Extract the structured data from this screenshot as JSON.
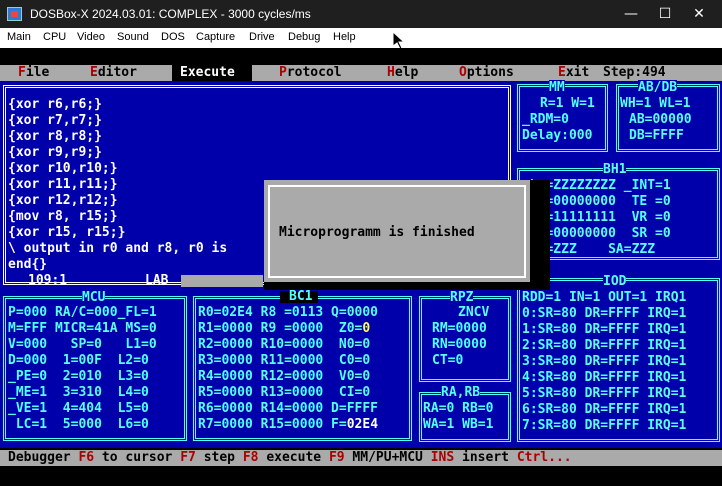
{
  "window": {
    "title": "DOSBox-X 2024.03.01: COMPLEX - 3000 cycles/ms",
    "icon": "dosbox-icon",
    "controls": {
      "minimize": "—",
      "maximize": "☐",
      "close": "✕"
    }
  },
  "menubar": [
    "Main",
    "CPU",
    "Video",
    "Sound",
    "DOS",
    "Capture",
    "Drive",
    "Debug",
    "Help"
  ],
  "topmenu": {
    "file": {
      "hot": "F",
      "rest": "ile"
    },
    "editor": {
      "hot": "E",
      "rest": "ditor"
    },
    "execute": {
      "hot": "E",
      "rest": "xecute"
    },
    "protocol": {
      "hot": "P",
      "rest": "rotocol"
    },
    "help": {
      "hot": "H",
      "rest": "elp"
    },
    "options": {
      "hot": "O",
      "rest": "ptions"
    },
    "exit": {
      "hot": "E",
      "rest": "xit"
    },
    "step": "Step:494"
  },
  "editor": {
    "lines": [
      "{xor r6,r6;}",
      "{xor r7,r7;}",
      "{xor r8,r8;}",
      "{xor r9,r9;}",
      "{xor r10,r10;}",
      "{xor r11,r11;}",
      "{xor r12,r12;}",
      "{mov r8, r15;}",
      "{xor r15, r15;}",
      "\\ output in r0 and r8, r0 is",
      "end{}"
    ],
    "status_pos": "109:1",
    "status_name": "LAB"
  },
  "dialog": {
    "message": "Microprogramm is finished"
  },
  "mm": {
    "title": "MM",
    "lines": [
      "R=1 W=1",
      "_RDM=0",
      "Delay:000"
    ]
  },
  "abdb": {
    "title": "AB/DB",
    "lines": [
      "WH=1 WL=1",
      "AB=00000",
      "DB=FFFF"
    ]
  },
  "bh1": {
    "title": "BH1",
    "lines": [
      "sk =ZZZZZZZZ _INT=1",
      "RA =00000000  TE =0",
      "RQ =11111111  VR =0",
      "IN =00000000  SR =0",
      "EC =ZZZ    SA=ZZZ"
    ]
  },
  "iod": {
    "title": "IOD",
    "header": "RDD=1 IN=1 OUT=1 IRQ1",
    "lines": [
      "0:SR=80 DR=FFFF IRQ=1",
      "1:SR=80 DR=FFFF IRQ=1",
      "2:SR=80 DR=FFFF IRQ=1",
      "3:SR=80 DR=FFFF IRQ=1",
      "4:SR=80 DR=FFFF IRQ=1",
      "5:SR=80 DR=FFFF IRQ=1",
      "6:SR=80 DR=FFFF IRQ=1",
      "7:SR=80 DR=FFFF IRQ=1"
    ]
  },
  "mcu": {
    "title": "MCU",
    "lines": [
      "P=000 RA/C=000_FL=1",
      "M=FFF MICR=41A MS=0",
      "V=000   SP=0   L1=0",
      "D=000  1=00F  L2=0",
      "_PE=0  2=010  L3=0",
      "_ME=1  3=310  L4=0",
      "_VE=1  4=404  L5=0",
      " LC=1  5=000  L6=0"
    ]
  },
  "bc1": {
    "title": "BC1",
    "lines": [
      "R0=02E4 R8 =0113 Q=0000",
      "R1=0000 R9 =0000  Z0=",
      "R2=0000 R10=0000  N0=0",
      "R3=0000 R11=0000  C0=0",
      "R4=0000 R12=0000  V0=0",
      "R5=0000 R13=0000  CI=0",
      "R6=0000 R14=0000 D=FFFF",
      "R7=0000 R15=0000 F="
    ],
    "z0_value": "0",
    "f_value": "02E4"
  },
  "rpz": {
    "title": "RPZ",
    "lines": [
      "ZNCV",
      "RM=0000",
      "RN=0000",
      "CT=0"
    ]
  },
  "rarb": {
    "title": "RA,RB",
    "lines": [
      "RA=0 RB=0",
      "WA=1 WB=1"
    ]
  },
  "statusbar": {
    "items": [
      {
        "key": "",
        "label": "Debugger"
      },
      {
        "key": "F6",
        "label": " to cursor"
      },
      {
        "key": "F7",
        "label": " step"
      },
      {
        "key": "F8",
        "label": " execute"
      },
      {
        "key": "F9",
        "label": " MM/PU+MCU"
      },
      {
        "key": "INS",
        "label": " insert"
      },
      {
        "key": "Ctrl...",
        "label": ""
      }
    ]
  },
  "colors": {
    "dos_blue": "#0000aa",
    "dos_cyan": "#55ffff",
    "dos_gray": "#aaaaaa",
    "dos_red": "#aa0000"
  }
}
